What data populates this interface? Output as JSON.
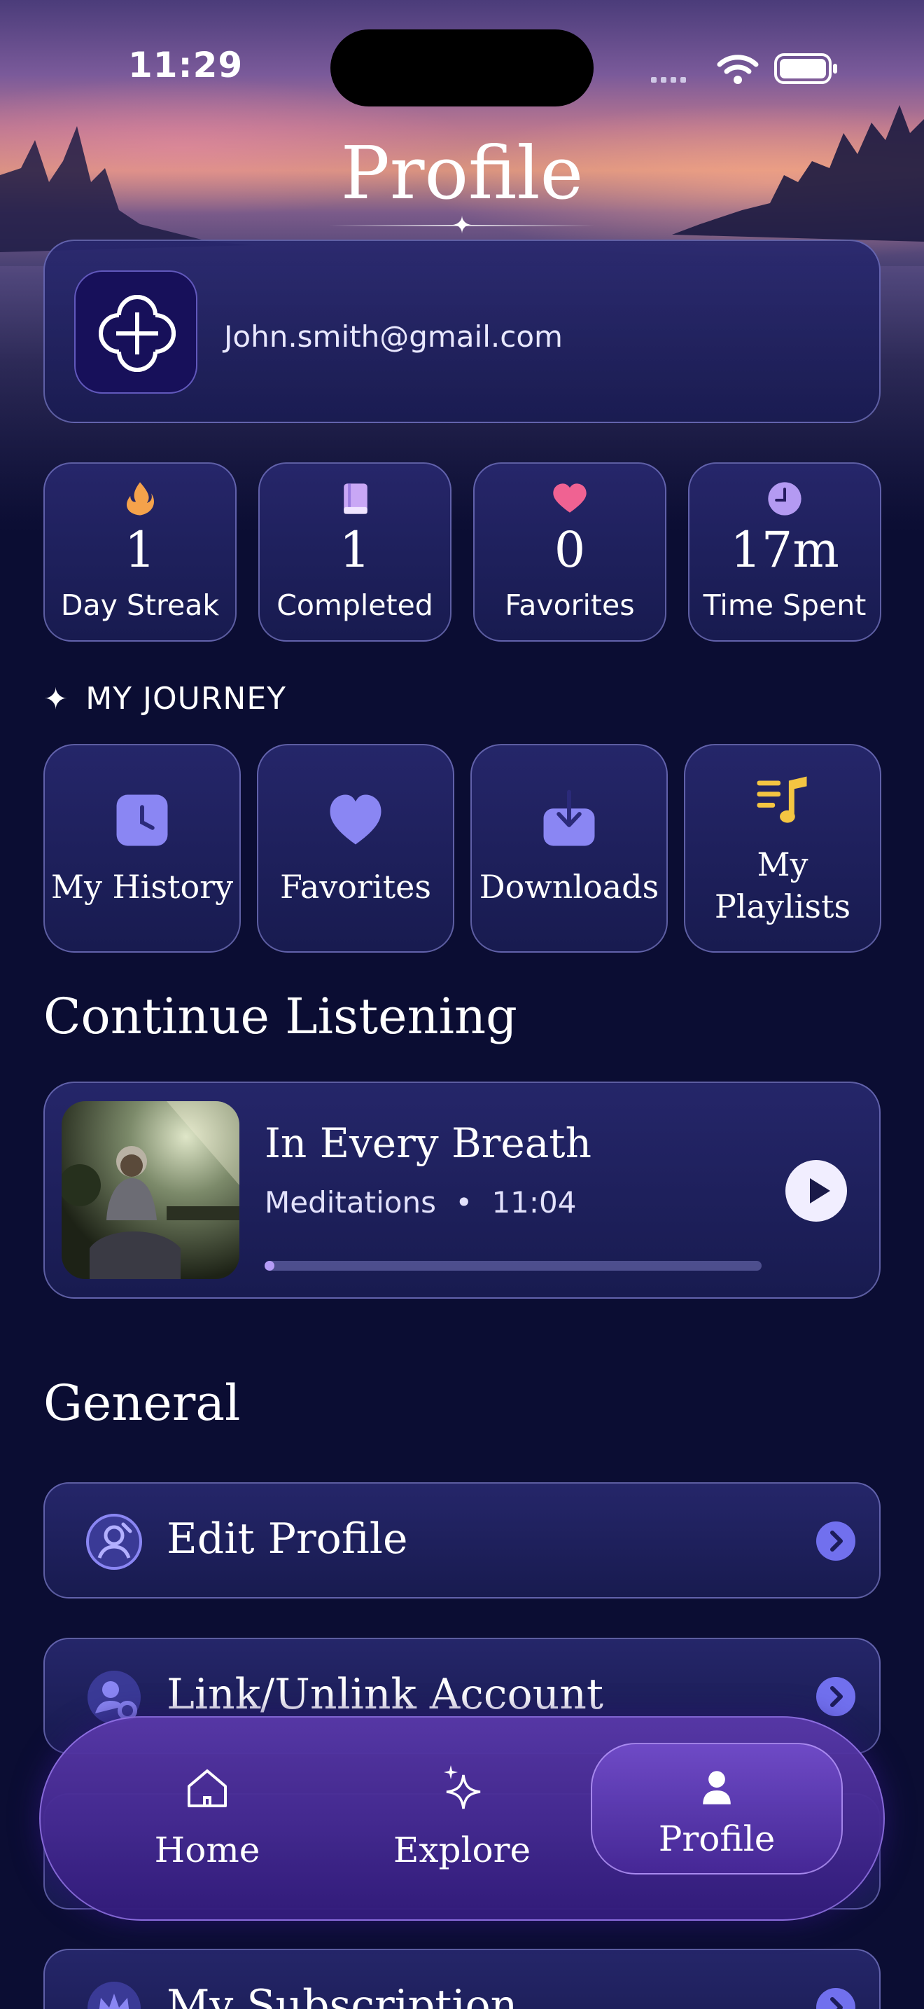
{
  "status_bar": {
    "time": "11:29"
  },
  "header": {
    "title": "Profile"
  },
  "profile": {
    "email": "John.smith@gmail.com"
  },
  "stats": [
    {
      "icon": "flame-icon",
      "value": "1",
      "label": "Day Streak"
    },
    {
      "icon": "book-icon",
      "value": "1",
      "label": "Completed"
    },
    {
      "icon": "heart-icon",
      "value": "0",
      "label": "Favorites"
    },
    {
      "icon": "clock-icon",
      "value": "17m",
      "label": "Time Spent"
    }
  ],
  "journey": {
    "heading": "MY JOURNEY",
    "tiles": [
      {
        "icon": "history-clock-icon",
        "label": "My History"
      },
      {
        "icon": "heart-icon",
        "label": "Favorites"
      },
      {
        "icon": "download-icon",
        "label": "Downloads"
      },
      {
        "icon": "playlist-icon",
        "label_line1": "My",
        "label_line2": "Playlists"
      }
    ]
  },
  "continue_listening": {
    "heading": "Continue Listening",
    "title": "In Every Breath",
    "category": "Meditations",
    "separator": "•",
    "duration": "11:04",
    "progress": 0.02
  },
  "general": {
    "heading": "General",
    "items": [
      {
        "icon": "user-edit-icon",
        "label": "Edit Profile"
      },
      {
        "icon": "user-gear-icon",
        "label": "Link/Unlink Account"
      },
      {
        "icon": "crown-icon",
        "label": "My Subscription"
      }
    ]
  },
  "tabbar": {
    "tabs": [
      {
        "icon": "home-icon",
        "label": "Home",
        "active": false
      },
      {
        "icon": "sparkle-icon",
        "label": "Explore",
        "active": false
      },
      {
        "icon": "person-icon",
        "label": "Profile",
        "active": true
      }
    ]
  },
  "colors": {
    "background": "#0b0d33",
    "accent": "#7170ee",
    "flame": "#f5a24b",
    "heart": "#f06292",
    "note": "#f4c542"
  }
}
